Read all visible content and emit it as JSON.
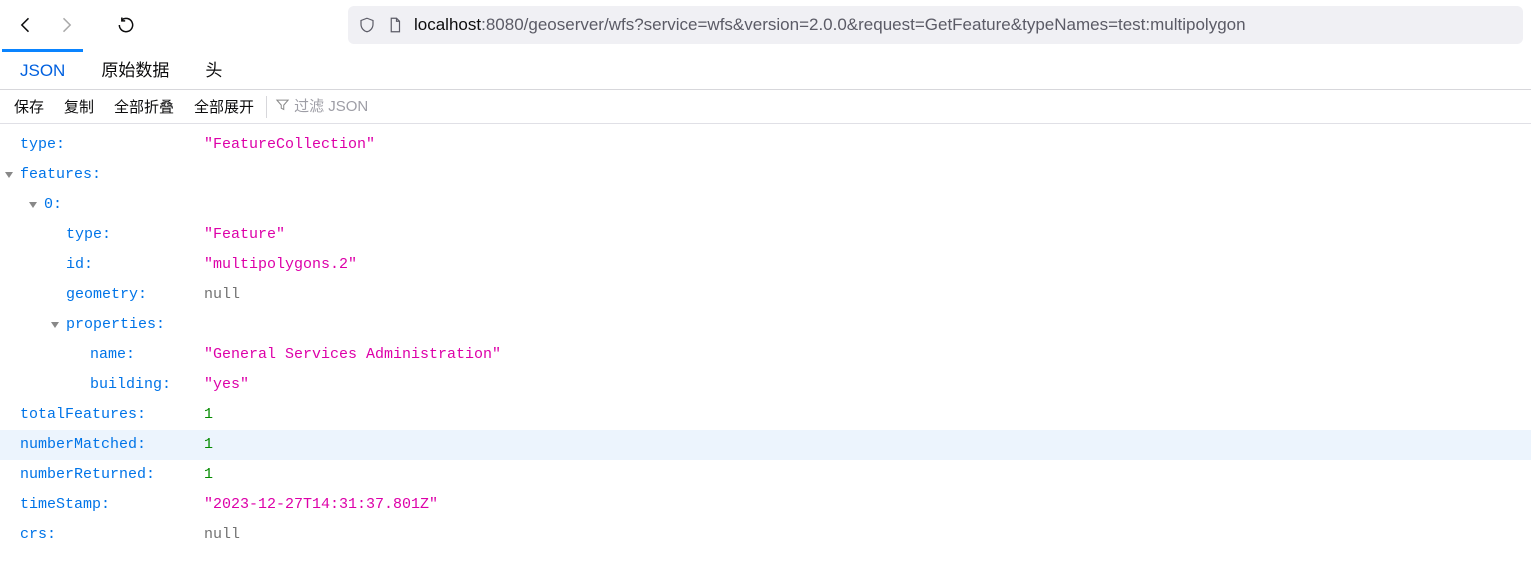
{
  "url": {
    "host": "localhost",
    "rest": ":8080/geoserver/wfs?service=wfs&version=2.0.0&request=GetFeature&typeNames=test:multipolygon"
  },
  "tabs": {
    "json": "JSON",
    "raw": "原始数据",
    "headers": "头"
  },
  "actions": {
    "save": "保存",
    "copy": "复制",
    "collapse": "全部折叠",
    "expand": "全部展开"
  },
  "filter": {
    "placeholder": "过滤 JSON"
  },
  "json": {
    "type_key": "type:",
    "type_val": "\"FeatureCollection\"",
    "features_key": "features:",
    "idx0_key": "0:",
    "f_type_key": "type:",
    "f_type_val": "\"Feature\"",
    "f_id_key": "id:",
    "f_id_val": "\"multipolygons.2\"",
    "f_geom_key": "geometry:",
    "f_geom_val": "null",
    "f_props_key": "properties:",
    "p_name_key": "name:",
    "p_name_val": "\"General Services Administration\"",
    "p_building_key": "building:",
    "p_building_val": "\"yes\"",
    "totalFeatures_key": "totalFeatures:",
    "totalFeatures_val": "1",
    "numberMatched_key": "numberMatched:",
    "numberMatched_val": "1",
    "numberReturned_key": "numberReturned:",
    "numberReturned_val": "1",
    "timeStamp_key": "timeStamp:",
    "timeStamp_val": "\"2023-12-27T14:31:37.801Z\"",
    "crs_key": "crs:",
    "crs_val": "null"
  },
  "indent": {
    "l1": 20,
    "l2": 44,
    "l3": 66,
    "l4": 90,
    "val_start": 204
  }
}
